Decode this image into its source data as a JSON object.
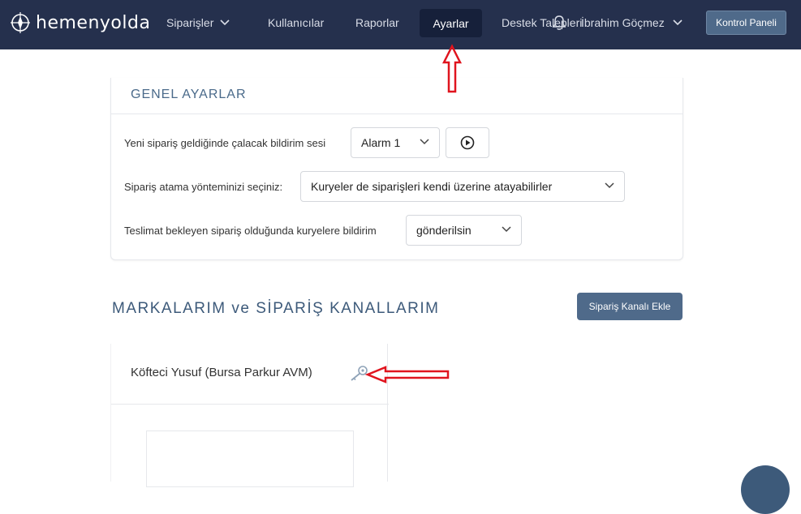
{
  "brand": {
    "name": "hemenyolda"
  },
  "nav": {
    "items": [
      {
        "label": "Siparişler",
        "has_dropdown": true
      },
      {
        "label": "Kullanıcılar"
      },
      {
        "label": "Raporlar"
      },
      {
        "label": "Ayarlar",
        "active": true
      },
      {
        "label": "Destek Talepleri"
      }
    ],
    "user_name": "İbrahim Göçmez",
    "control_panel_label": "Kontrol Paneli"
  },
  "general_settings": {
    "title": "GENEL AYARLAR",
    "sound_label": "Yeni sipariş geldiğinde çalacak bildirim sesi",
    "sound_value": "Alarm 1",
    "assign_label": "Sipariş atama yönteminizi seçiniz:",
    "assign_value": "Kuryeler de siparişleri kendi üzerine atayabilirler",
    "notify_label": "Teslimat bekleyen sipariş olduğunda kuryelere bildirim",
    "notify_value": "gönderilsin"
  },
  "brands": {
    "title": "MARKALARIM ve SİPARİŞ KANALLARIM",
    "add_button": "Sipariş Kanalı Ekle",
    "items": [
      {
        "name": "Köfteci Yusuf (Bursa Parkur AVM)"
      }
    ]
  },
  "colors": {
    "navbar": "#25304d",
    "nav_active": "#16203a",
    "button": "#4f6a8a",
    "annotation_arrow": "#e0141e"
  },
  "icons": [
    "compass-logo-icon",
    "chevron-down-icon",
    "bell-icon",
    "play-circle-icon",
    "key-icon"
  ]
}
